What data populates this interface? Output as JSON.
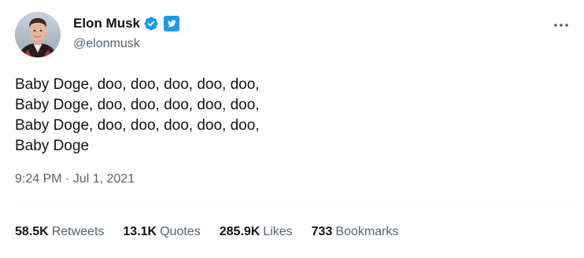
{
  "author": {
    "display_name": "Elon Musk",
    "handle": "@elonmusk",
    "verified": true,
    "verified_color": "#1d9bf0"
  },
  "tweet": {
    "lines": [
      "Baby Doge, doo, doo, doo, doo, doo,",
      "Baby Doge, doo, doo, doo, doo, doo,",
      "Baby Doge, doo, doo, doo, doo, doo,",
      "Baby Doge"
    ],
    "timestamp": "9:24 PM · Jul 1, 2021"
  },
  "stats": {
    "retweets": {
      "count": "58.5K",
      "label": "Retweets"
    },
    "quotes": {
      "count": "13.1K",
      "label": "Quotes"
    },
    "likes": {
      "count": "285.9K",
      "label": "Likes"
    },
    "bookmarks": {
      "count": "733",
      "label": "Bookmarks"
    }
  },
  "icons": {
    "verified": "verified-badge-icon",
    "twitter_badge": "twitter-bird-badge-icon",
    "more": "more-options-icon"
  }
}
